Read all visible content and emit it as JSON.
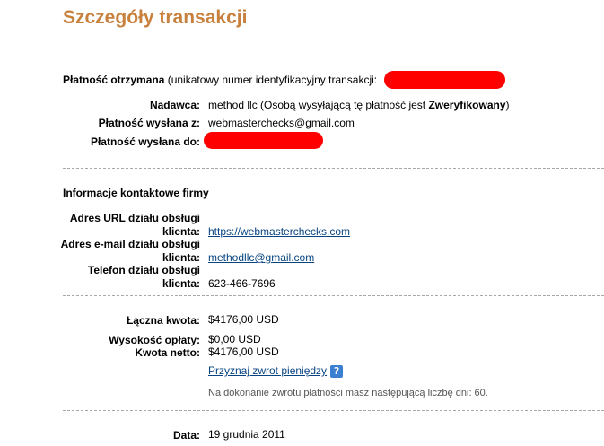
{
  "page_title": "Szczegóły transakcji",
  "payment": {
    "received_bold": "Płatność otrzymana",
    "received_text": " (unikatowy numer identyfikacyjny transakcji: ",
    "sender_label": "Nadawca:",
    "sender_name": "method llc",
    "sender_note_prefix": " (Osobą wysyłającą tę płatność jest ",
    "sender_status": "Zweryfikowany",
    "sender_note_suffix": ")",
    "sent_from_label": "Płatność wysłana z:",
    "sent_from_value": "webmasterchecks@gmail.com",
    "sent_to_label": "Płatność wysłana do:"
  },
  "contact": {
    "heading": "Informacje kontaktowe firmy",
    "url_label_1": "Adres URL działu obsługi",
    "url_label_2": "klienta:",
    "url_value": "https://webmasterchecks.com",
    "email_label_1": "Adres e-mail działu obsługi",
    "email_label_2": "klienta:",
    "email_value": "methodllc@gmail.com",
    "phone_label_1": "Telefon działu obsługi",
    "phone_label_2": "klienta:",
    "phone_value": "623-466-7696"
  },
  "amounts": {
    "total_label": "Łączna kwota:",
    "total_value": "$4176,00 USD",
    "fee_label": "Wysokość opłaty:",
    "fee_value": "$0,00 USD",
    "net_label": "Kwota netto:",
    "net_value": "$4176,00 USD",
    "refund_link": "Przyznaj zwrot pieniędzy",
    "help_icon": "?",
    "refund_note": "Na dokonanie zwrotu płatności masz następującą liczbę dni: 60."
  },
  "date": {
    "label": "Data:",
    "value": "19 grudnia 2011"
  },
  "colors": {
    "title": "#c8803d",
    "link": "#084482",
    "redaction": "#ff0000",
    "help_icon_bg": "#3b7fd1"
  }
}
